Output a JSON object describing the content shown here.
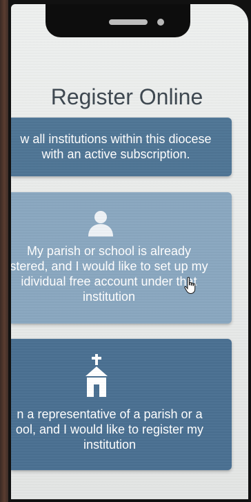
{
  "page": {
    "title": "Register Online"
  },
  "options": [
    {
      "text": "w all institutions within this diocese\nwith an active subscription."
    },
    {
      "icon": "person-icon",
      "text": "My parish or school is already\nstered, and I would like to set up my\nidividual free account under that\ninstitution"
    },
    {
      "icon": "church-icon",
      "text": "n a representative of a parish or a\nool, and I would like to register my\ninstitution"
    }
  ],
  "colors": {
    "card_dark": "#4f7595",
    "card_light": "#8aa7c0",
    "title": "#3d4750",
    "screen_bg": "#eef0ef"
  }
}
